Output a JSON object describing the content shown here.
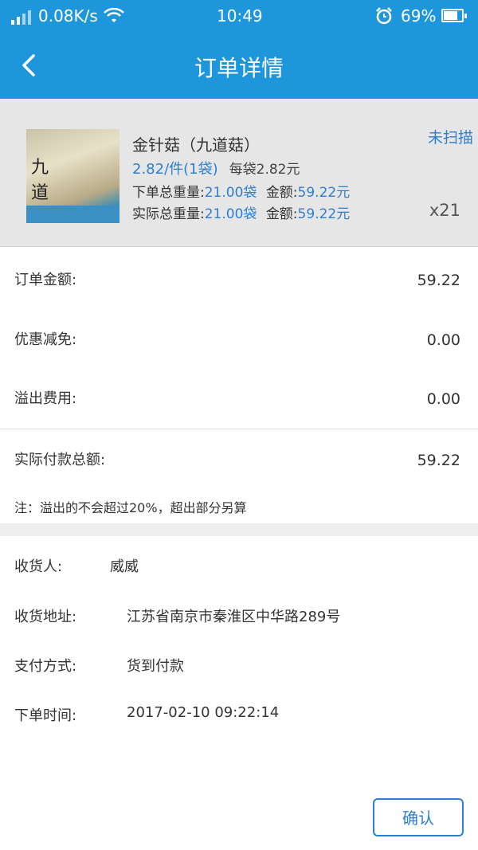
{
  "status_bar": {
    "speed": "0.08K/s",
    "time": "10:49",
    "battery": "69%"
  },
  "header": {
    "title": "订单详情",
    "back_icon": "chevron-left-icon"
  },
  "product": {
    "name": "金针菇（九道菇）",
    "scan_status": "未扫描",
    "unit_price": "2.82/件(1袋)",
    "per_bag": "每袋2.82元",
    "order_weight_label": "下单总重量:",
    "order_weight": "21.00袋",
    "amount_label": "金额:",
    "order_amount": "59.22元",
    "actual_weight_label": "实际总重量:",
    "actual_weight": "21.00袋",
    "actual_amount": "59.22元",
    "quantity": "x21"
  },
  "summary": {
    "order_amount_label": "订单金额:",
    "order_amount": "59.22",
    "discount_label": "优惠减免:",
    "discount": "0.00",
    "overflow_label": "溢出费用:",
    "overflow": "0.00",
    "actual_total_label": "实际付款总额:",
    "actual_total": "59.22",
    "note": "注：溢出的不会超过20%，超出部分另算"
  },
  "delivery": {
    "receiver_label": "收货人:",
    "receiver": "威威",
    "address_label": "收货地址:",
    "address": "江苏省南京市秦淮区中华路289号",
    "payment_label": "支付方式:",
    "payment": "货到付款",
    "time_label": "下单时间:",
    "time": "2017-02-10 09:22:14"
  },
  "actions": {
    "confirm_label": "确认"
  },
  "colors": {
    "brand": "#1e96dc",
    "accent": "#2e7fd0"
  }
}
